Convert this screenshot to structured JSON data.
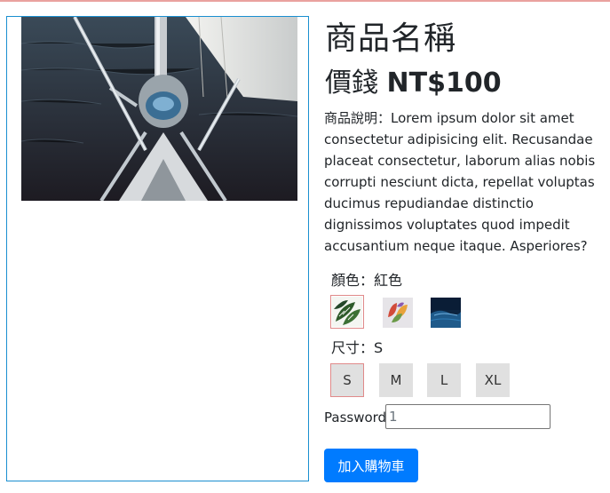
{
  "product": {
    "name": "商品名稱",
    "price_label": "價錢",
    "price_value": "NT$100",
    "description": "商品說明：Lorem ipsum dolor sit amet consectetur adipisicing elit. Recusandae placeat consectetur, laborum alias nobis corrupti nesciunt dicta, repellat voluptas ducimus repudiandae distinctio dignissimos voluptates quod impedit accusantium neque itaque. Asperiores?"
  },
  "color": {
    "label": "顏色：紅色",
    "options": [
      {
        "icon": "monstera-leaf-swatch",
        "selected": true
      },
      {
        "icon": "autumn-leaves-swatch",
        "selected": false
      },
      {
        "icon": "ocean-swatch",
        "selected": false
      }
    ]
  },
  "size": {
    "label": "尺寸：S",
    "options": [
      {
        "label": "S",
        "selected": true
      },
      {
        "label": "M",
        "selected": false
      },
      {
        "label": "L",
        "selected": false
      },
      {
        "label": "XL",
        "selected": false
      }
    ]
  },
  "password": {
    "label": "Password",
    "value": "1"
  },
  "cart": {
    "button_label": "加入購物車"
  },
  "colors": {
    "primary": "#007bff",
    "panel_border": "#1a8fd0",
    "selected_border": "#e08a8a",
    "size_bg": "#e0e0e0"
  }
}
